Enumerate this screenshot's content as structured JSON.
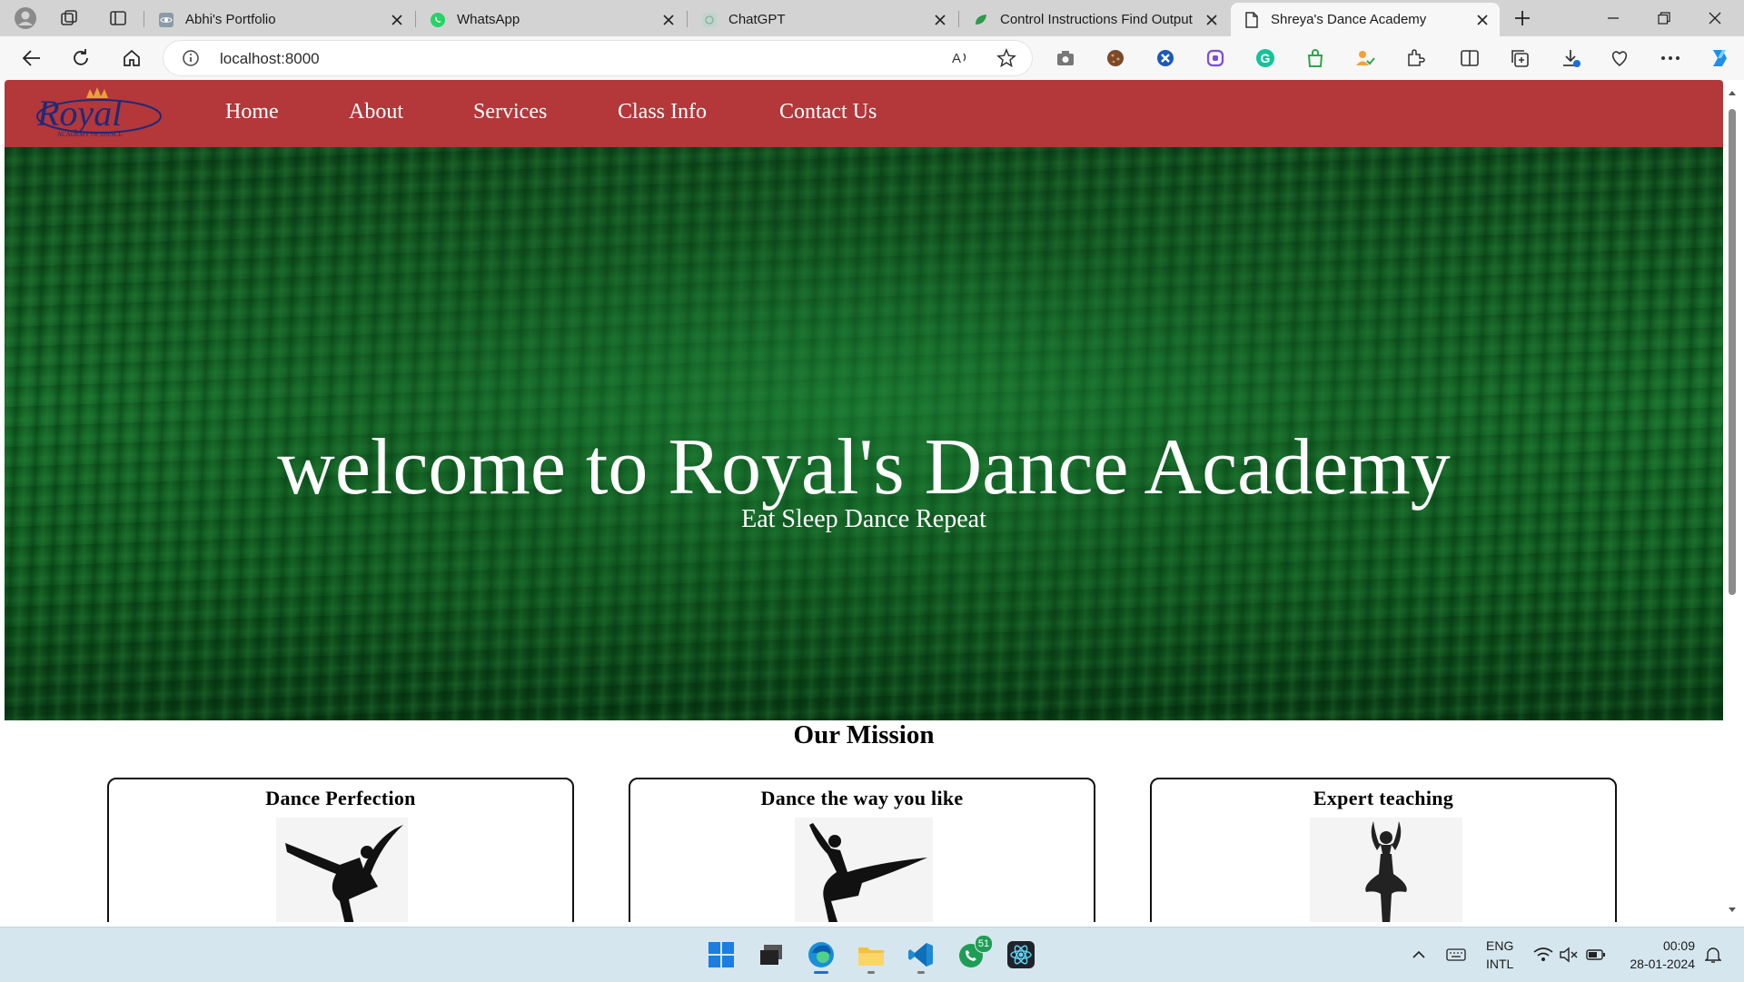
{
  "browser": {
    "tabs": [
      {
        "title": "Abhi's Portfolio",
        "icon": "react-icon"
      },
      {
        "title": "WhatsApp",
        "icon": "whatsapp-icon"
      },
      {
        "title": "ChatGPT",
        "icon": "chatgpt-icon"
      },
      {
        "title": "Control Instructions Find Output",
        "icon": "leaf-icon"
      },
      {
        "title": "Shreya's Dance Academy",
        "icon": "page-icon",
        "active": true
      }
    ],
    "url": "localhost:8000"
  },
  "site": {
    "logo_text": "Royal",
    "logo_subtext": "ACADEMY OF DANCE",
    "nav": [
      "Home",
      "About",
      "Services",
      "Class Info",
      "Contact Us"
    ],
    "hero": {
      "title": "welcome to Royal's Dance Academy",
      "subtitle": "Eat Sleep Dance Repeat"
    },
    "mission": {
      "title": "Our Mission",
      "cards": [
        {
          "title": "Dance Perfection",
          "image": "ballerina-arabesque"
        },
        {
          "title": "Dance the way you like",
          "image": "ballerina-leap"
        },
        {
          "title": "Expert teaching",
          "image": "ballerina-standing"
        }
      ]
    }
  },
  "taskbar": {
    "whatsapp_badge": "51",
    "lang_line1": "ENG",
    "lang_line2": "INTL",
    "time": "00:09",
    "date": "28-01-2024"
  },
  "colors": {
    "navbar": "#b4373a",
    "hero_green": "#146a28",
    "tabbar": "#d3d3d3"
  }
}
